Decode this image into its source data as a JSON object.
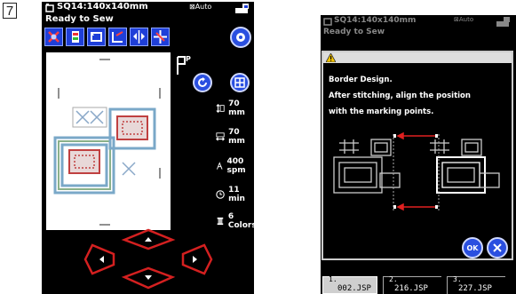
{
  "step_number": "7",
  "left_screen": {
    "header": {
      "design_name": "SQ14:140x140mm",
      "auto_label": "Auto"
    },
    "status": "Ready to Sew",
    "info": {
      "height": "70 mm",
      "width": "70 mm",
      "speed": "400 spm",
      "time": "11 min",
      "colors": "6 Colors"
    },
    "colors": {
      "background": "#000000",
      "accent": "#1f3fd8",
      "arrow": "#d42020"
    }
  },
  "right_screen": {
    "header": {
      "design_name": "SQ14:140x140mm",
      "auto_label": "Auto"
    },
    "status": "Ready to Sew",
    "dialog": {
      "title": "Border Design.",
      "line2": "After stitching, align the position",
      "line3": "with the marking points.",
      "ok_label": "OK"
    },
    "tabs": [
      {
        "number": "1.",
        "file": "002.JSP"
      },
      {
        "number": "2.",
        "file": "216.JSP"
      },
      {
        "number": "3.",
        "file": "227.JSP"
      }
    ]
  }
}
